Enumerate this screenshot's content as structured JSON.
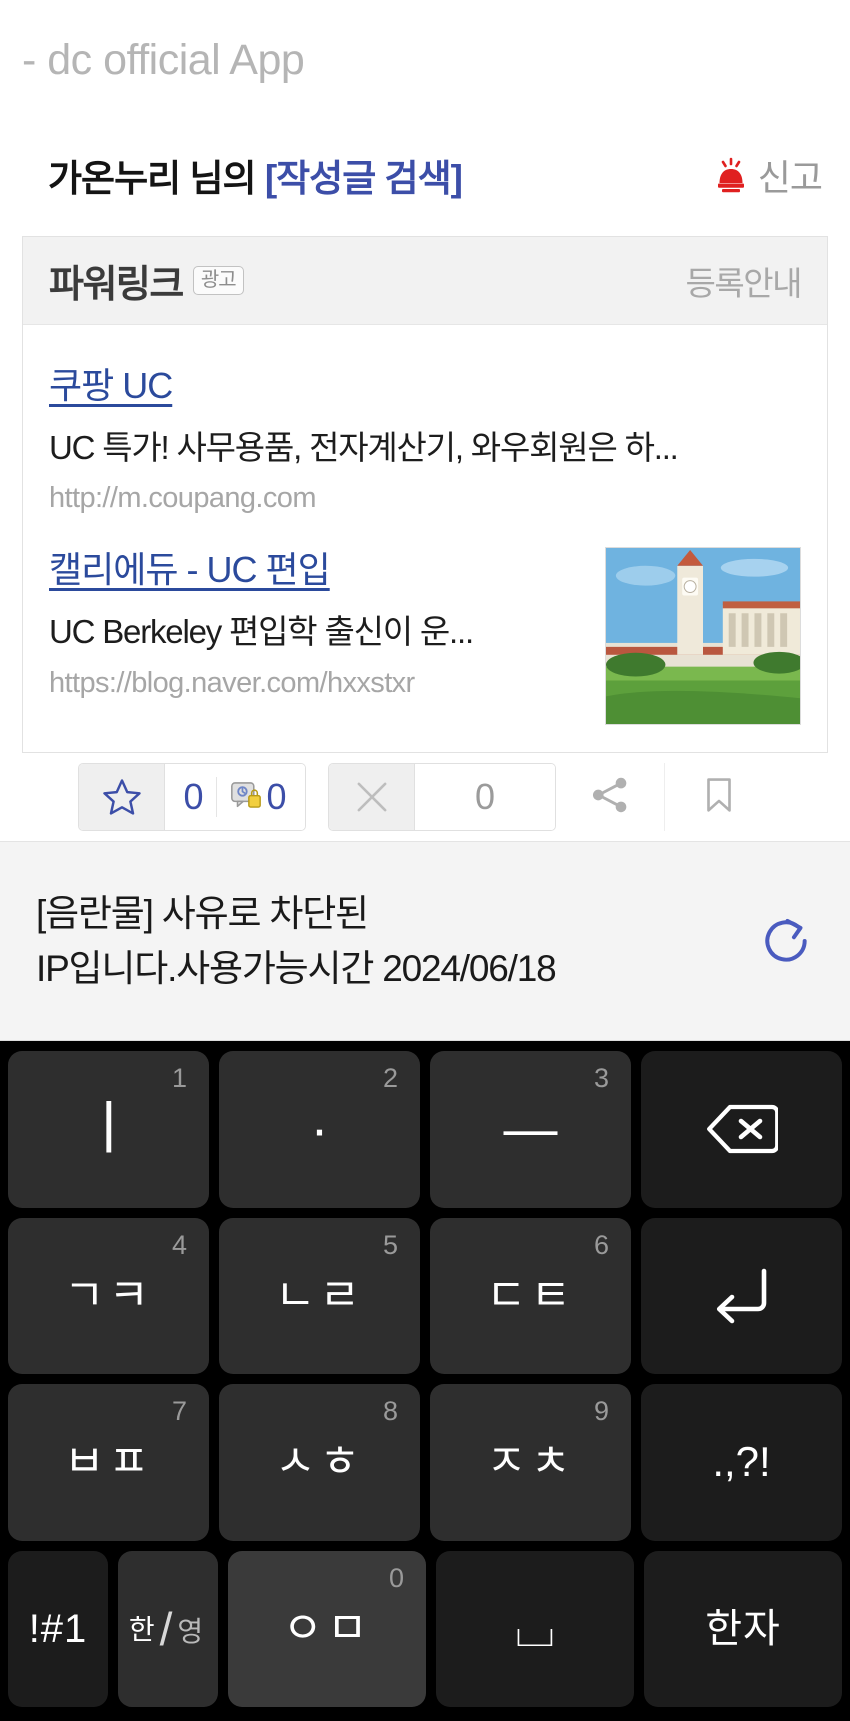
{
  "app": {
    "title": "- dc official App"
  },
  "search_header": {
    "nickname_part": "가온누리 님의 ",
    "search_label": "[작성글 검색]",
    "report_label": "신고",
    "report_icon": "siren-icon"
  },
  "powerlink": {
    "title": "파워링크",
    "ad_badge": "광고",
    "register_label": "등록안내",
    "ads": [
      {
        "link_text": "쿠팡 UC",
        "description": "UC 특가! 사무용품, 전자계산기, 와우회원은 하...",
        "url": "http://m.coupang.com",
        "has_thumbnail": false
      },
      {
        "link_text": "캘리에듀 - UC 편입",
        "description": "UC Berkeley 편입학 출신이 운...",
        "url": "https://blog.naver.com/hxxstxr",
        "has_thumbnail": true,
        "thumbnail_alt": "UC Berkeley campanile tower"
      }
    ]
  },
  "action_bar": {
    "recommend_icon": "star-icon",
    "recommend_count": "0",
    "comment_icon": "comment-lock-icon",
    "comment_count": "0",
    "dislike_icon": "x-icon",
    "dislike_count": "0",
    "share_icon": "share-icon",
    "bookmark_icon": "bookmark-icon"
  },
  "warning": {
    "line1": "[음란물] 사유로 차단된",
    "line2": "IP입니다.사용가능시간 2024/06/18",
    "refresh_icon": "refresh-icon"
  },
  "keyboard": {
    "rows": [
      [
        {
          "label": "ㅣ",
          "sup": "1",
          "type": "char",
          "glyph_class": "vbar"
        },
        {
          "label": "·",
          "sup": "2",
          "type": "char",
          "glyph_class": "dot"
        },
        {
          "label": "—",
          "sup": "3",
          "type": "char",
          "glyph_class": "dash"
        },
        {
          "label": "",
          "sup": "",
          "type": "backspace",
          "icon": "backspace-icon"
        }
      ],
      [
        {
          "label": "ㄱㅋ",
          "sup": "4",
          "type": "char",
          "glyph_class": ""
        },
        {
          "label": "ㄴㄹ",
          "sup": "5",
          "type": "char",
          "glyph_class": ""
        },
        {
          "label": "ㄷㅌ",
          "sup": "6",
          "type": "char",
          "glyph_class": ""
        },
        {
          "label": "",
          "sup": "",
          "type": "enter",
          "icon": "enter-icon"
        }
      ],
      [
        {
          "label": "ㅂㅍ",
          "sup": "7",
          "type": "char",
          "glyph_class": ""
        },
        {
          "label": "ㅅㅎ",
          "sup": "8",
          "type": "char",
          "glyph_class": ""
        },
        {
          "label": "ㅈㅊ",
          "sup": "9",
          "type": "char",
          "glyph_class": ""
        },
        {
          "label": ".,?!",
          "sup": "",
          "type": "char",
          "glyph_class": "punct"
        }
      ]
    ],
    "bottom_row": {
      "symbols_key": "!#1",
      "lang_key_top": "한",
      "lang_key_bottom": "영",
      "consonant_key": "ㅇㅁ",
      "consonant_sup": "0",
      "space_key": "⌴",
      "hanja_key": "한자"
    }
  },
  "colors": {
    "accent_blue": "#3c4ea8",
    "link_blue": "#2b4a9c",
    "siren_red": "#e02020",
    "keyboard_bg": "#000000",
    "key_bg": "#2e2e2e"
  }
}
